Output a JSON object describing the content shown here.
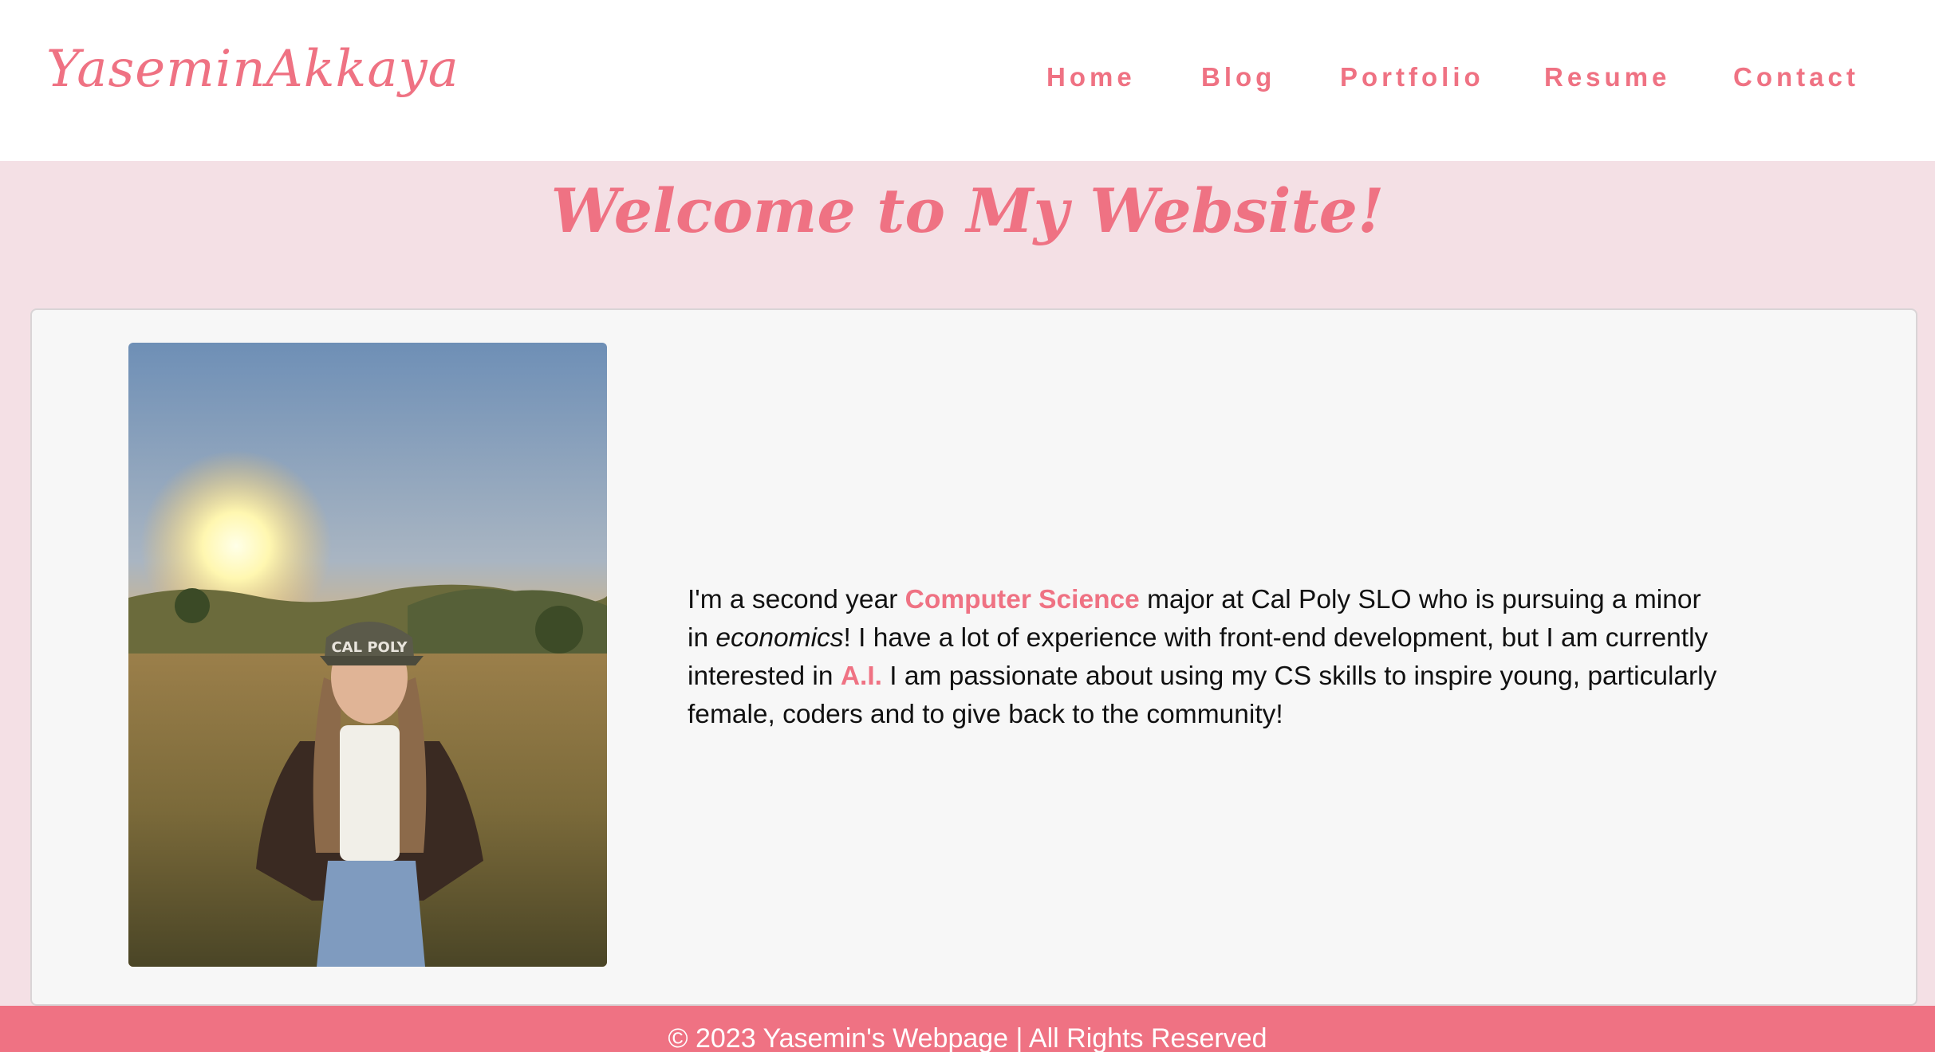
{
  "header": {
    "logo": "YaseminAkkaya",
    "nav": [
      "Home",
      "Blog",
      "Portfolio",
      "Resume",
      "Contact"
    ]
  },
  "hero": {
    "title": "Welcome to My Website!"
  },
  "about": {
    "photo_alt": "Yasemin in a field at sunset wearing a Cal Poly cap",
    "cap_text": "CAL POLY",
    "bio": {
      "p1": "I'm a second year ",
      "h1": "Computer Science",
      "p2": " major at Cal Poly SLO who is pursuing a minor in ",
      "i1": "economics",
      "p3": "! I have a lot of experience with front-end development, but I am currently interested in ",
      "h2": "A.I.",
      "p4": " I am passionate about using my CS skills to inspire young, particularly female, coders and to give back to the community!"
    }
  },
  "footer": {
    "text": "© 2023 Yasemin's Webpage | All Rights Reserved"
  },
  "colors": {
    "accent": "#ef7283",
    "page_bg": "#f4e0e5",
    "card_bg": "#f7f7f7",
    "header_bg": "#ffffff"
  }
}
